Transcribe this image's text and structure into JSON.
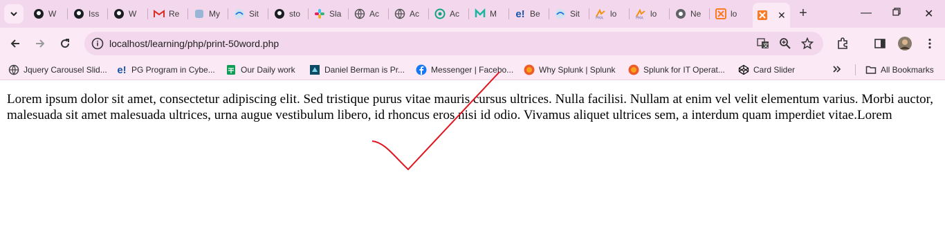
{
  "tabs": [
    {
      "label": "W",
      "icon": "github-icon"
    },
    {
      "label": "Iss",
      "icon": "github-icon"
    },
    {
      "label": "W",
      "icon": "github-icon"
    },
    {
      "label": "Re",
      "icon": "gmail-icon"
    },
    {
      "label": "My",
      "icon": "app-icon"
    },
    {
      "label": "Sit",
      "icon": "site-icon"
    },
    {
      "label": "sto",
      "icon": "github-icon"
    },
    {
      "label": "Sla",
      "icon": "slack-icon"
    },
    {
      "label": "Ac",
      "icon": "globe-icon"
    },
    {
      "label": "Ac",
      "icon": "globe-icon"
    },
    {
      "label": "Ac",
      "icon": "chatgpt-icon"
    },
    {
      "label": "M",
      "icon": "app-icon"
    },
    {
      "label": "Be",
      "icon": "edureka-icon"
    },
    {
      "label": "Sit",
      "icon": "site-icon"
    },
    {
      "label": "lo",
      "icon": "phpmyadmin-icon"
    },
    {
      "label": "lo",
      "icon": "phpmyadmin-icon"
    },
    {
      "label": "Ne",
      "icon": "chrome-icon"
    },
    {
      "label": "lo",
      "icon": "xampp-icon"
    }
  ],
  "active_tab": {
    "label": "",
    "icon": "xampp-icon"
  },
  "address_bar": {
    "url": "localhost/learning/php/print-50word.php"
  },
  "bookmarks": [
    {
      "label": "Jquery Carousel Slid...",
      "icon": "globe-icon"
    },
    {
      "label": "PG Program in Cybe...",
      "icon": "edureka-icon"
    },
    {
      "label": "Our Daily work",
      "icon": "sheets-icon"
    },
    {
      "label": "Daniel Berman is Pr...",
      "icon": "site-icon"
    },
    {
      "label": "Messenger | Facebo...",
      "icon": "facebook-icon"
    },
    {
      "label": "Why Splunk | Splunk",
      "icon": "splunk-icon"
    },
    {
      "label": "Splunk for IT Operat...",
      "icon": "splunk-icon"
    },
    {
      "label": "Card Slider",
      "icon": "codepen-icon"
    }
  ],
  "all_bookmarks": "All Bookmarks",
  "page": {
    "text": "Lorem ipsum dolor sit amet, consectetur adipiscing elit. Sed tristique purus vitae mauris cursus ultrices. Nulla facilisi. Nullam at enim vel velit elementum varius. Morbi auctor, malesuada sit amet malesuada ultrices, urna augue vestibulum libero, id rhoncus eros nisi id odio. Vivamus aliquet ultrices sem, a interdum quam imperdiet vitae.Lorem"
  },
  "colors": {
    "tabstrip": "#f3d7ec",
    "toolbar": "#fbeaf6",
    "checkmark": "#e0141e"
  }
}
